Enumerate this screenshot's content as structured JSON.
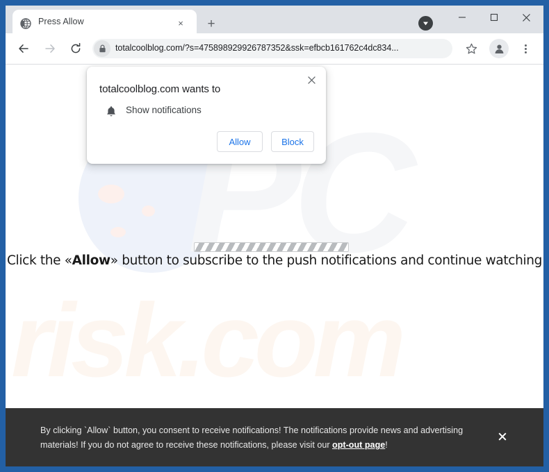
{
  "browser": {
    "tab": {
      "title": "Press Allow",
      "favicon": "globe-icon",
      "close_label": "×"
    },
    "new_tab_label": "+",
    "window_controls": {
      "minimize": "–",
      "maximize": "□",
      "close": "✕"
    },
    "download_indicator": "download-arrow-icon",
    "toolbar": {
      "back": "back-arrow-icon",
      "forward": "forward-arrow-icon",
      "reload": "reload-icon",
      "lock": "lock-icon",
      "url": "totalcoolblog.com/?s=475898929926787352&ssk=efbcb161762c4dc834...",
      "bookmark": "star-icon",
      "profile": "profile-avatar-icon",
      "menu": "three-dot-menu-icon"
    }
  },
  "notification_dialog": {
    "title": "totalcoolblog.com wants to",
    "permission_icon": "bell-icon",
    "permission_label": "Show notifications",
    "allow_label": "Allow",
    "block_label": "Block",
    "close_label": "✕"
  },
  "page": {
    "headline_prefix": "Click the «",
    "headline_bold": "Allow",
    "headline_suffix": "» button to subscribe to the push notifications and continue watching",
    "progress_bar": "striped-loading-bar",
    "watermark_top": "PC",
    "watermark_bottom": "risk.com"
  },
  "consent_banner": {
    "text_before_link": "By clicking `Allow` button, you consent to receive notifications! The notifications provide news and advertising materials! If you do not agree to receive these notifications, please visit our ",
    "link_label": "opt-out page",
    "text_after_link": "!",
    "close_label": "✕"
  },
  "colors": {
    "window_frame": "#2360a5",
    "tab_strip": "#dee1e6",
    "omnibox": "#f1f3f4",
    "accent_blue": "#1a73e8",
    "banner_background": "#333333",
    "watermark_blue": "#eef2fa",
    "watermark_cream": "#fdf6f0"
  }
}
